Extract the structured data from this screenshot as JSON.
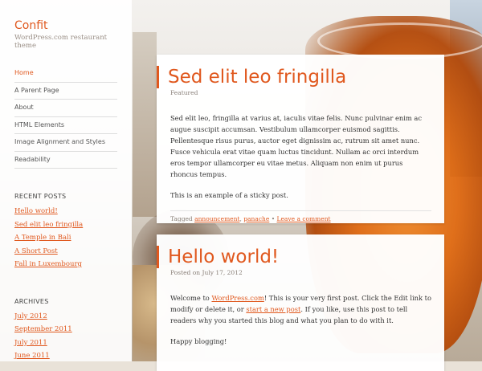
{
  "site": {
    "title": "Confit",
    "description": "WordPress.com restaurant theme"
  },
  "nav": {
    "items": [
      {
        "label": "Home"
      },
      {
        "label": "A Parent Page"
      },
      {
        "label": "About"
      },
      {
        "label": "HTML Elements"
      },
      {
        "label": "Image Alignment and Styles"
      },
      {
        "label": "Readability"
      }
    ]
  },
  "recent_posts": {
    "title": "RECENT POSTS",
    "items": [
      {
        "label": "Hello world!"
      },
      {
        "label": "Sed elit leo fringilla"
      },
      {
        "label": "A Temple in Bali"
      },
      {
        "label": "A Short Post"
      },
      {
        "label": "Fall in Luxembourg"
      }
    ]
  },
  "archives": {
    "title": "ARCHIVES",
    "items": [
      {
        "label": "July 2012"
      },
      {
        "label": "September 2011"
      },
      {
        "label": "July 2011"
      },
      {
        "label": "June 2011"
      }
    ]
  },
  "posts": [
    {
      "title": "Sed elit leo fringilla",
      "meta": "Featured",
      "paragraph1": "Sed elit leo, fringilla at varius at, iaculis vitae felis. Nunc pulvinar enim ac augue suscipit accumsan. Vestibulum ullamcorper euismod sagittis. Pellentesque risus purus, auctor eget dignissim ac, rutrum sit amet nunc. Fusce vehicula erat vitae quam luctus tincidunt. Nullam ac orci interdum eros tempor ullamcorper eu vitae metus. Aliquam non enim ut purus rhoncus tempus.",
      "paragraph2": "This is an example of a sticky post.",
      "footer": {
        "tagged_prefix": "Tagged",
        "tag1": "announcement",
        "sep1": ",",
        "tag2": "panache",
        "sep2": "•",
        "comment_link": "Leave a comment"
      }
    },
    {
      "title": "Hello world!",
      "meta_prefix": "Posted on",
      "meta_date": "July 17, 2012",
      "para1_a": "Welcome to ",
      "para1_link1": "WordPress.com",
      "para1_b": "! This is your very first post. Click the Edit link to modify or delete it, or ",
      "para1_link2": "start a new post",
      "para1_c": ". If you like, use this post to tell readers why you started this blog and what you plan to do with it.",
      "paragraph2": "Happy blogging!"
    }
  ],
  "colors": {
    "accent": "#e0581e"
  }
}
